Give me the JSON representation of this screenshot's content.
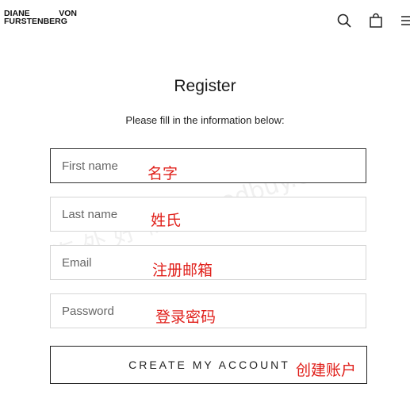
{
  "brand": {
    "logo_line1_left": "DIANE",
    "logo_line1_right": "VON",
    "logo_line2": "FURSTENBERG"
  },
  "header_icons": [
    "search-icon",
    "shopping-bag-icon",
    "menu-icon"
  ],
  "form": {
    "title": "Register",
    "subtitle": "Please fill in the information below:",
    "fields": [
      {
        "placeholder": "First name",
        "note": "名字"
      },
      {
        "placeholder": "Last name",
        "note": "姓氏"
      },
      {
        "placeholder": "Email",
        "note": "注册邮箱"
      },
      {
        "placeholder": "Password",
        "note": "登录密码"
      }
    ],
    "submit_label": "CREATE MY ACCOUNT",
    "submit_note": "创建账户"
  },
  "watermark": "海 外 好 物 olgoodbuy.com",
  "colors": {
    "annotation": "#e0201b",
    "active_border": "#333333",
    "border": "#d6d6d6"
  }
}
